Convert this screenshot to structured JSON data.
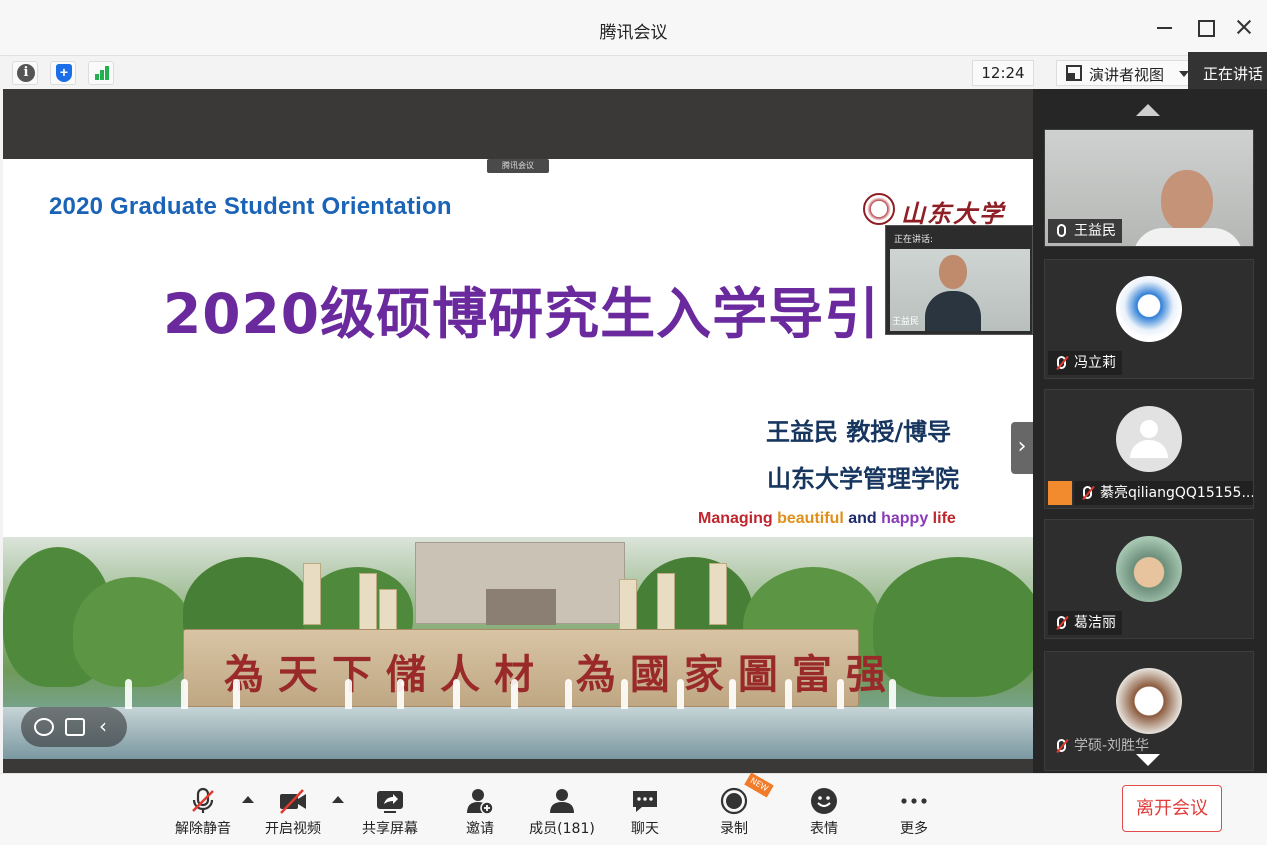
{
  "window": {
    "title": "腾讯会议"
  },
  "infobar": {
    "time": "12:24",
    "view_label": "演讲者视图",
    "speaking_tag": "正在讲话"
  },
  "slide": {
    "share_tag": "腾讯会议",
    "en_title": "2020 Graduate Student Orientation",
    "uni_name": "山东大学",
    "cn_title": "2020级硕博研究生入学导引",
    "presenter": "王益民  教授/博导",
    "school": "山东大学管理学院",
    "slogan_parts": [
      {
        "text": "Managing ",
        "color": "#c0262e"
      },
      {
        "text": "beautiful ",
        "color": "#e0901a"
      },
      {
        "text": "and ",
        "color": "#1f2a6a"
      },
      {
        "text": "happy ",
        "color": "#8a3ab9"
      },
      {
        "text": "life",
        "color": "#c0262e"
      }
    ],
    "stone_text": "為天下儲人材 為國家圖富强"
  },
  "pip": {
    "label": "正在讲话:",
    "name": "王益民"
  },
  "participants": [
    {
      "name": "王益民",
      "muted": false
    },
    {
      "name": "冯立莉",
      "muted": true
    },
    {
      "name": "綦亮qiliangQQ15155...",
      "muted": true
    },
    {
      "name": "葛洁丽",
      "muted": true
    },
    {
      "name": "学硕-刘胜华",
      "muted": true
    }
  ],
  "toolbar": {
    "unmute": "解除静音",
    "start_video": "开启视频",
    "share_screen": "共享屏幕",
    "invite": "邀请",
    "members": "成员(181)",
    "chat": "聊天",
    "record": "录制",
    "record_badge": "NEW",
    "reactions": "表情",
    "more": "更多",
    "leave": "离开会议"
  }
}
